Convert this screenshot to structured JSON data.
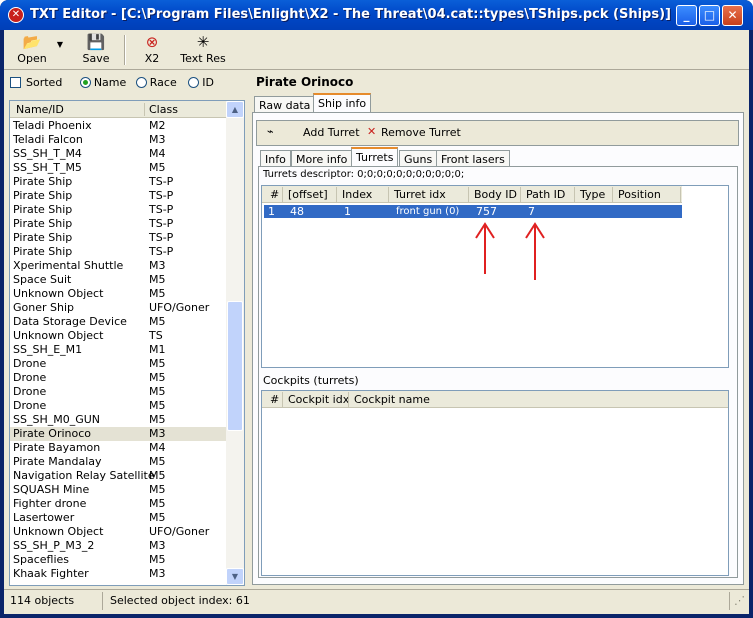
{
  "window": {
    "title": "TXT Editor - [C:\\Program Files\\Enlight\\X2 - The Threat\\04.cat::types\\TShips.pck (Ships)]",
    "minimize_glyph": "_",
    "maximize_glyph": "□",
    "close_glyph": "✕"
  },
  "toolbar": {
    "open_label": "Open",
    "save_label": "Save",
    "x2_label": "X2",
    "textres_label": "Text Res"
  },
  "options": {
    "sorted_label": "Sorted",
    "name_label": "Name",
    "race_label": "Race",
    "id_label": "ID",
    "selected": "Name"
  },
  "list": {
    "col_name": "Name/ID",
    "col_class": "Class",
    "rows": [
      {
        "name": "Teladi Phoenix",
        "cls": "M2"
      },
      {
        "name": "Teladi Falcon",
        "cls": "M3"
      },
      {
        "name": "SS_SH_T_M4",
        "cls": "M4"
      },
      {
        "name": "SS_SH_T_M5",
        "cls": "M5"
      },
      {
        "name": "Pirate Ship",
        "cls": "TS-P"
      },
      {
        "name": "Pirate Ship",
        "cls": "TS-P"
      },
      {
        "name": "Pirate Ship",
        "cls": "TS-P"
      },
      {
        "name": "Pirate Ship",
        "cls": "TS-P"
      },
      {
        "name": "Pirate Ship",
        "cls": "TS-P"
      },
      {
        "name": "Pirate Ship",
        "cls": "TS-P"
      },
      {
        "name": "Xperimental Shuttle",
        "cls": "M3"
      },
      {
        "name": "Space Suit",
        "cls": "M5"
      },
      {
        "name": "Unknown Object",
        "cls": "M5"
      },
      {
        "name": "Goner Ship",
        "cls": "UFO/Goner"
      },
      {
        "name": "Data Storage Device",
        "cls": "M5"
      },
      {
        "name": "Unknown Object",
        "cls": "TS"
      },
      {
        "name": "SS_SH_E_M1",
        "cls": "M1"
      },
      {
        "name": "Drone",
        "cls": "M5"
      },
      {
        "name": "Drone",
        "cls": "M5"
      },
      {
        "name": "Drone",
        "cls": "M5"
      },
      {
        "name": "Drone",
        "cls": "M5"
      },
      {
        "name": "SS_SH_M0_GUN",
        "cls": "M5"
      },
      {
        "name": "Pirate Orinoco",
        "cls": "M3",
        "selected": true
      },
      {
        "name": "Pirate Bayamon",
        "cls": "M4"
      },
      {
        "name": "Pirate Mandalay",
        "cls": "M5"
      },
      {
        "name": "Navigation Relay Satellite",
        "cls": "M5"
      },
      {
        "name": "SQUASH Mine",
        "cls": "M5"
      },
      {
        "name": "Fighter drone",
        "cls": "M5"
      },
      {
        "name": "Lasertower",
        "cls": "M5"
      },
      {
        "name": "Unknown Object",
        "cls": "UFO/Goner"
      },
      {
        "name": "SS_SH_P_M3_2",
        "cls": "M3"
      },
      {
        "name": "Spaceflies",
        "cls": "M5"
      },
      {
        "name": "Khaak Fighter",
        "cls": "M3"
      }
    ]
  },
  "detail": {
    "object_title": "Pirate Orinoco",
    "tabs_top": [
      "Raw data",
      "Ship info"
    ],
    "add_turret_label": "Add Turret",
    "remove_turret_label": "Remove Turret",
    "tabs_inner": [
      "Info",
      "More info",
      "Turrets",
      "Guns",
      "Front lasers"
    ],
    "turrets_descriptor": "Turrets descriptor: 0;0;0;0;0;0;0;0;0;0;0;",
    "turret_columns": [
      "#",
      "[offset]",
      "Index",
      "Turret idx",
      "Body ID",
      "Path ID",
      "Type",
      "Position"
    ],
    "turret_row": {
      "num": "1",
      "offset": "48",
      "index": "1",
      "turret_idx": "front gun (0)",
      "body_id": "757",
      "path_id": "7",
      "type": "",
      "position": ""
    },
    "cockpits_label": "Cockpits (turrets)",
    "cockpit_columns": [
      "#",
      "Cockpit idx",
      "Cockpit name"
    ]
  },
  "status": {
    "count": "114 objects",
    "selected_index": "Selected object index: 61"
  },
  "colors": {
    "selection": "#316ac5",
    "arrow": "#e02020",
    "tab_accent": "#e68b2c"
  }
}
